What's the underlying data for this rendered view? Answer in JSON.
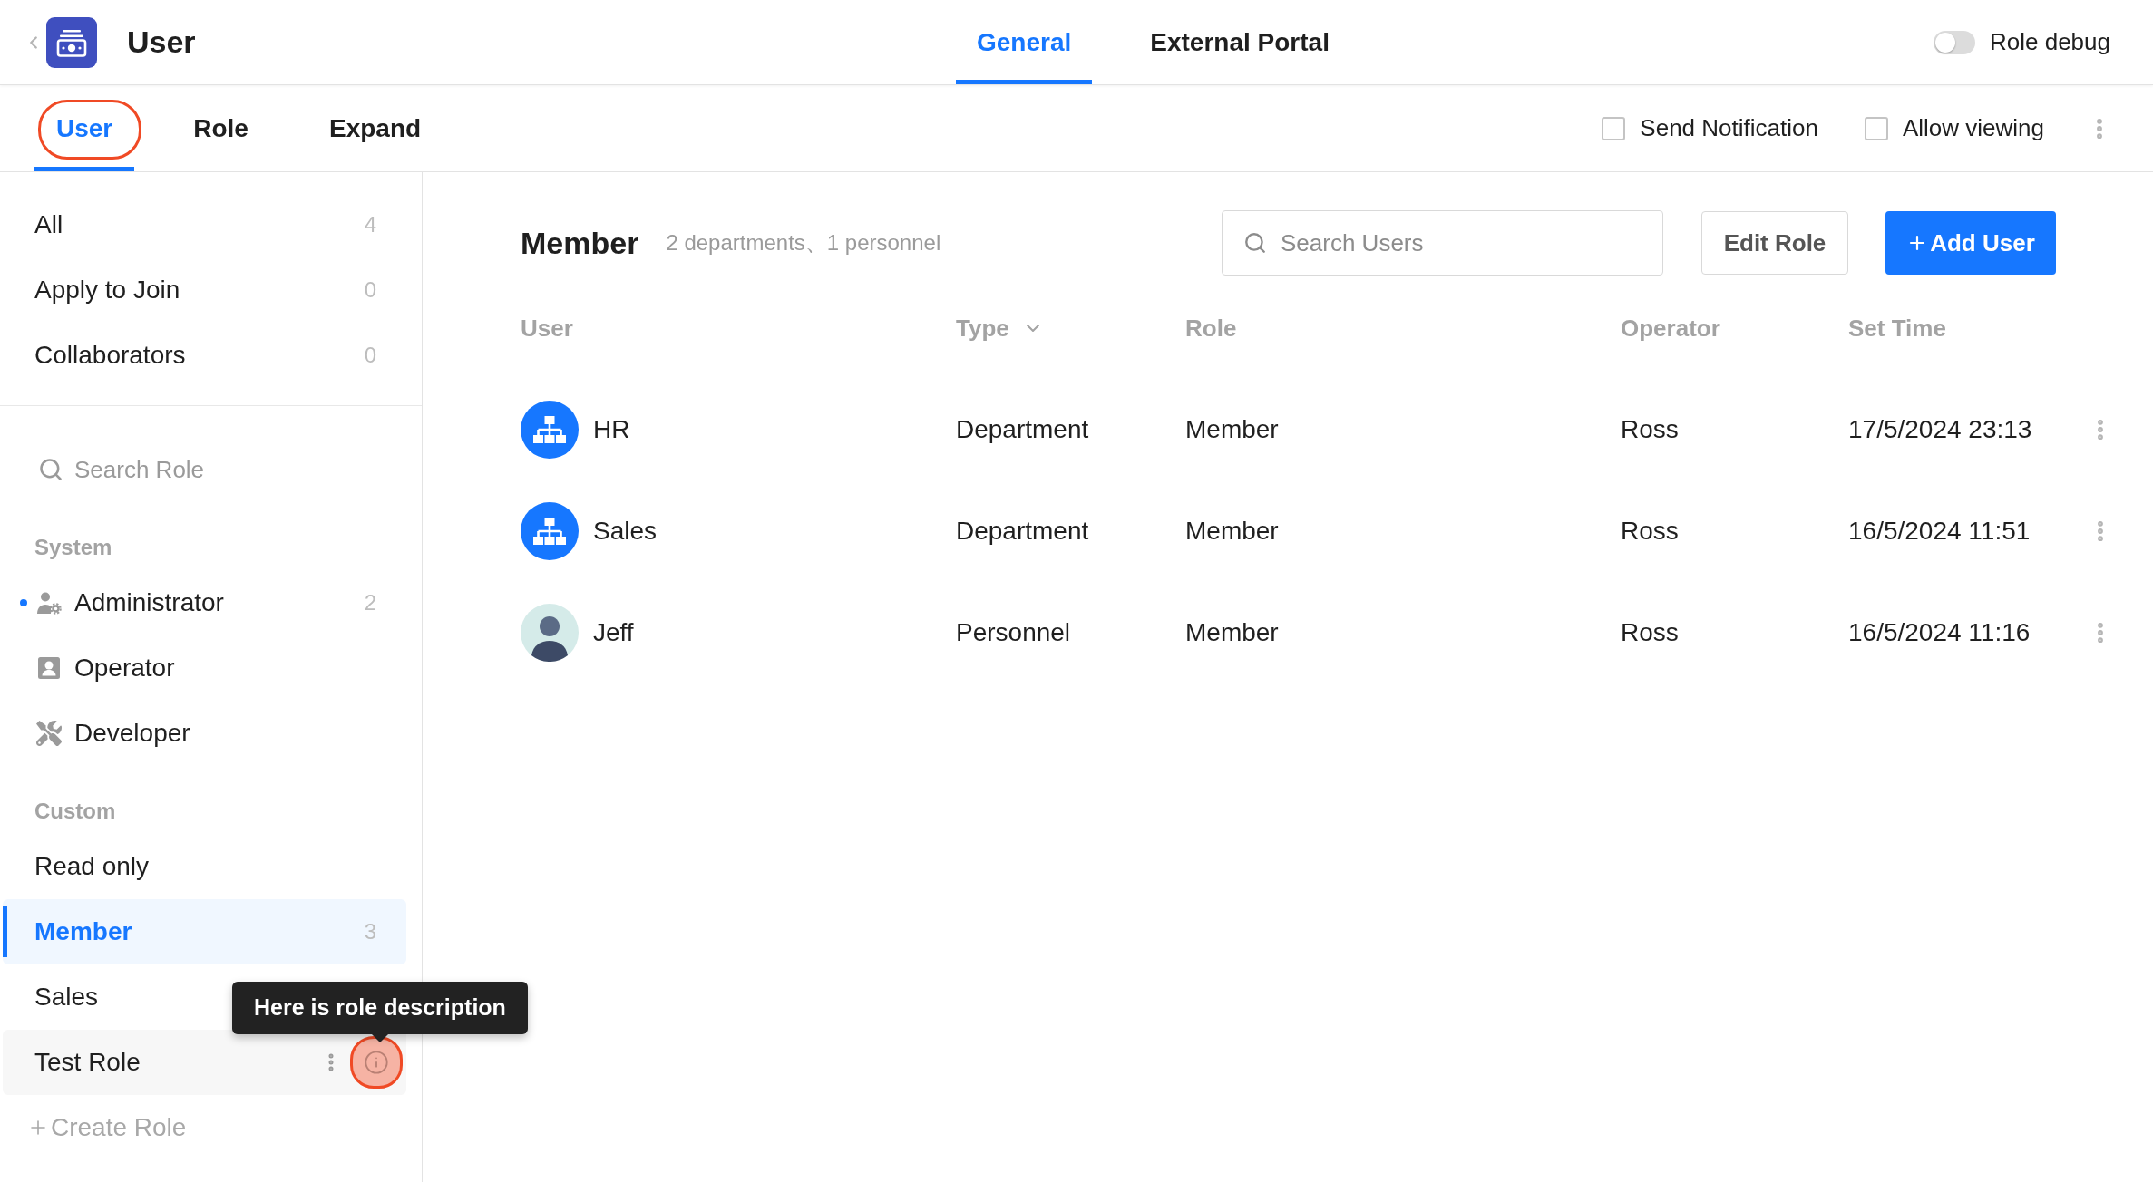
{
  "header": {
    "title": "User",
    "tabs": [
      {
        "label": "General",
        "selected": true
      },
      {
        "label": "External Portal",
        "selected": false
      }
    ],
    "role_debug": {
      "label": "Role debug",
      "on": false
    }
  },
  "subbar": {
    "tabs": [
      {
        "label": "User",
        "selected": true,
        "circled": true
      },
      {
        "label": "Role",
        "selected": false,
        "circled": false
      },
      {
        "label": "Expand",
        "selected": false,
        "circled": false
      }
    ],
    "options": [
      {
        "label": "Send Notification",
        "checked": false
      },
      {
        "label": "Allow viewing",
        "checked": false
      }
    ]
  },
  "sidebar": {
    "filters": [
      {
        "label": "All",
        "count": "4",
        "selected": false
      },
      {
        "label": "Apply to Join",
        "count": "0",
        "selected": false
      },
      {
        "label": "Collaborators",
        "count": "0",
        "selected": false
      }
    ],
    "search": {
      "placeholder": "Search Role"
    },
    "groups": [
      {
        "title": "System",
        "roles": [
          {
            "kind": "admin",
            "label": "Administrator",
            "count": "2",
            "marked": true,
            "selected": false,
            "hovered": false
          },
          {
            "kind": "operator",
            "label": "Operator",
            "marked": false,
            "selected": false,
            "hovered": false
          },
          {
            "kind": "developer",
            "label": "Developer",
            "marked": false,
            "selected": false,
            "hovered": false
          }
        ]
      },
      {
        "title": "Custom",
        "roles": [
          {
            "kind": "custom",
            "label": "Read only",
            "marked": false,
            "selected": false,
            "hovered": false
          },
          {
            "kind": "custom",
            "label": "Member",
            "count": "3",
            "marked": false,
            "selected": true,
            "hovered": false
          },
          {
            "kind": "custom",
            "label": "Sales",
            "marked": false,
            "selected": false,
            "hovered": false
          },
          {
            "kind": "custom",
            "label": "Test Role",
            "marked": false,
            "selected": false,
            "hovered": true,
            "tooltip": "Here is role description",
            "info_circled": true
          }
        ]
      }
    ],
    "create_role": "Create Role"
  },
  "main": {
    "title": "Member",
    "summary": "2 departments、1 personnel",
    "search": {
      "placeholder": "Search Users"
    },
    "buttons": [
      {
        "label": "Edit Role",
        "kind": "secondary"
      },
      {
        "label": "Add User",
        "kind": "primary"
      }
    ],
    "table": {
      "columns": [
        {
          "label": "User",
          "dropdown": false
        },
        {
          "label": "Type",
          "dropdown": true
        },
        {
          "label": "Role",
          "dropdown": false
        },
        {
          "label": "Operator",
          "dropdown": false
        },
        {
          "label": "Set Time",
          "dropdown": false
        }
      ],
      "rows": [
        {
          "kind": "group",
          "user": "HR",
          "type": "Department",
          "role": "Member",
          "operator": "Ross",
          "set_time": "17/5/2024 23:13"
        },
        {
          "kind": "group",
          "user": "Sales",
          "type": "Department",
          "role": "Member",
          "operator": "Ross",
          "set_time": "16/5/2024 11:51"
        },
        {
          "kind": "person",
          "user": "Jeff",
          "type": "Personnel",
          "role": "Member",
          "operator": "Ross",
          "set_time": "16/5/2024 11:16"
        }
      ]
    }
  }
}
